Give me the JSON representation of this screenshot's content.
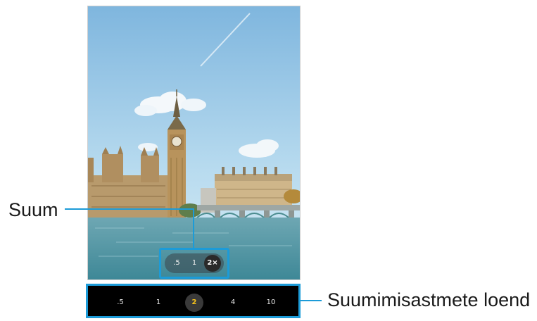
{
  "callouts": {
    "zoom_label": "Suum",
    "level_list_label": "Suumimisastmete loend"
  },
  "zoom_control": {
    "options": [
      ".5",
      "1",
      "2×"
    ],
    "selected": "2×"
  },
  "zoom_levels": {
    "items": [
      ".5",
      "1",
      "2",
      "4",
      "10"
    ],
    "selected": "2"
  },
  "colors": {
    "callout_line": "#1c9bd8",
    "selected_level": "#f6c21a",
    "level_bar_bg": "#000000"
  }
}
